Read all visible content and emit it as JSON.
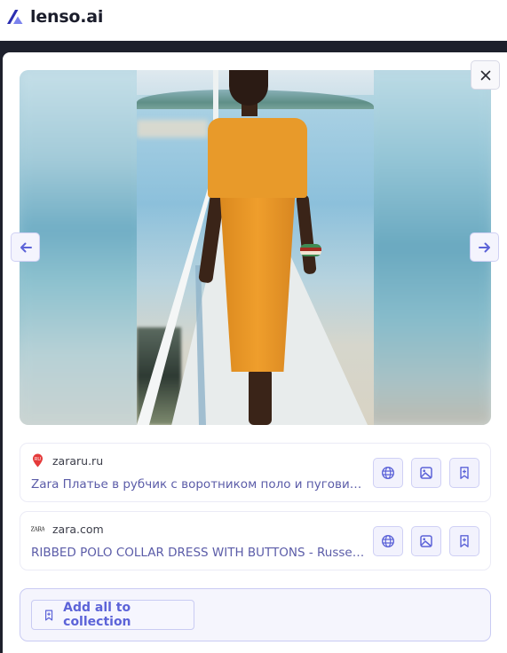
{
  "app": {
    "brand_name": "lenso.ai",
    "accent_color": "#5c63d8"
  },
  "modal": {
    "close_label": "×",
    "prev_label": "←",
    "next_label": "→",
    "image_alt": "Woman in orange ribbed polo collar dress walking on a white pier by the sea"
  },
  "results": [
    {
      "favicon": "ru-pin-icon",
      "domain": "zararu.ru",
      "title": "Zara Платье в рубчик с воротником поло и пуговица...",
      "actions": [
        "globe-icon",
        "image-icon",
        "bookmark-add-icon"
      ]
    },
    {
      "favicon": "zara-logo-icon",
      "domain": "zara.com",
      "title": "RIBBED POLO COLLAR DRESS WITH BUTTONS - Russet ...",
      "actions": [
        "globe-icon",
        "image-icon",
        "bookmark-add-icon"
      ]
    }
  ],
  "collection": {
    "add_all_label": "Add all to collection"
  }
}
